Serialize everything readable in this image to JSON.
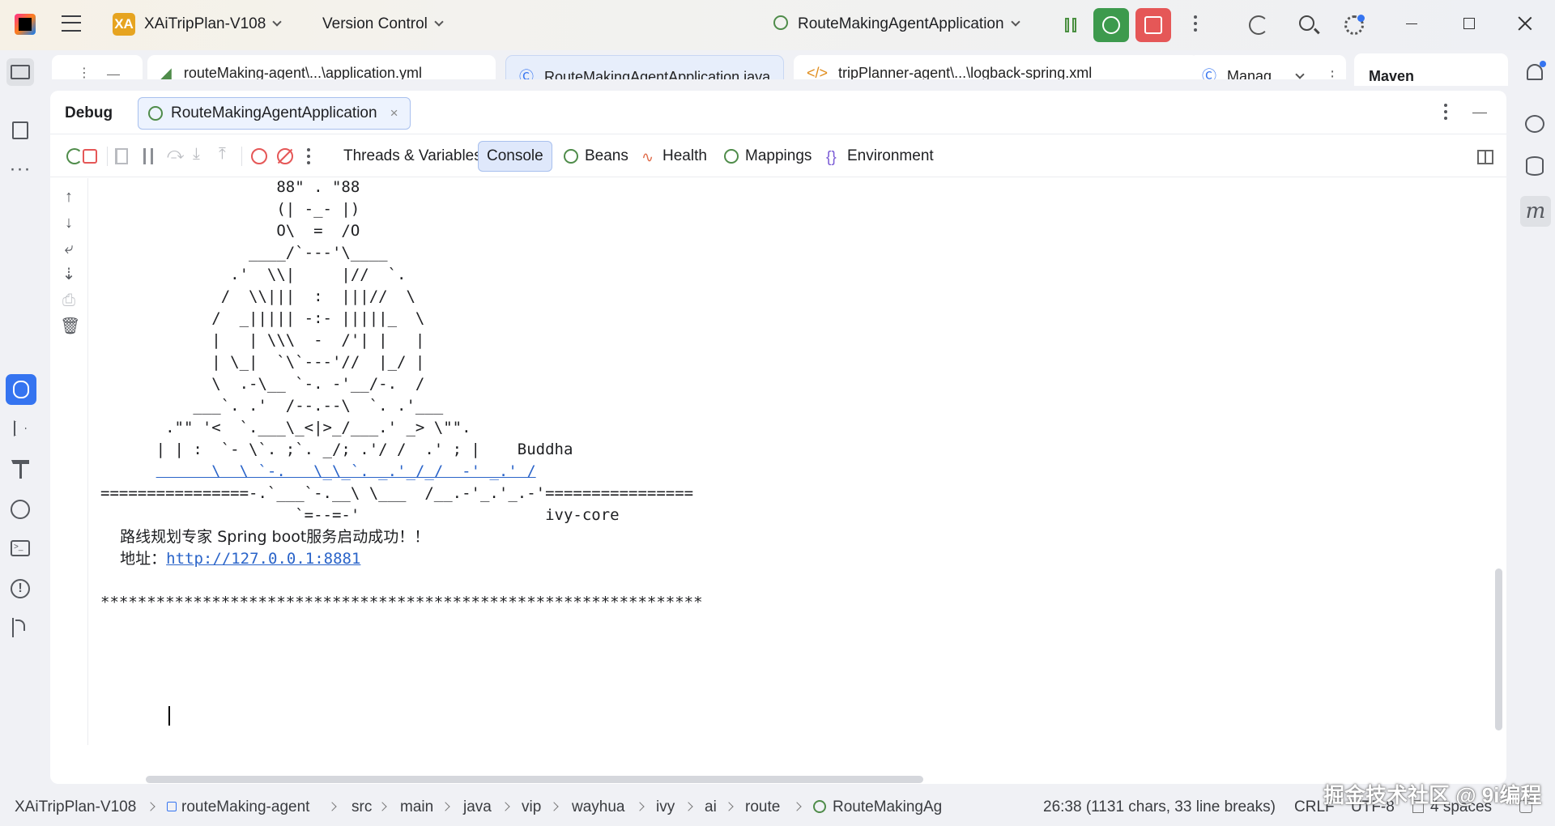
{
  "titlebar": {
    "project_badge": "XA",
    "project_name": "XAiTripPlan-V108",
    "vcs_label": "Version Control",
    "run_config": "RouteMakingAgentApplication"
  },
  "editor_tabs": [
    {
      "label": "routeMaking-agent\\...\\application.yml"
    },
    {
      "label": "RouteMakingAgentApplication.java"
    },
    {
      "label": "tripPlanner-agent\\...\\logback-spring.xml"
    },
    {
      "label": "Manag"
    }
  ],
  "right_panel_tab": "Maven",
  "debug": {
    "title": "Debug",
    "session_tab": "RouteMakingAgentApplication",
    "toolbar_tabs": {
      "threads": "Threads & Variables",
      "console": "Console",
      "beans": "Beans",
      "health": "Health",
      "mappings": "Mappings",
      "environment": "Environment"
    }
  },
  "console": {
    "art_lines": [
      "                   88\" . \"88",
      "                   (| -_- |)",
      "                   O\\  =  /O",
      "                ____/`---'\\____",
      "              .'  \\\\|     |//  `.",
      "             /  \\\\|||  :  |||//  \\",
      "            /  _||||| -:- |||||_  \\",
      "            |   | \\\\\\  -  /'| |   |",
      "            | \\_|  `\\`---'//  |_/ |",
      "            \\  .-\\__ `-. -'__/-.  /",
      "          ___`. .'  /--.--\\  `. .'___",
      "       .\"\" '<  `.___\\_<|>_/___.' _> \\\"\".",
      "      | | :  `- \\`. ;`. _/; .'/ /  .' ; |    Buddha"
    ],
    "link_line": "      \\  \\ `-.   \\_\\_`. _.'_/_/  -' _.' /",
    "equals_line": "================-.`___`-.__\\ \\___  /__.-'_.'_.-'================",
    "last_art_line": "                     `=--=-'                    ivy-core",
    "startup_msg": "    路线规划专家 Spring boot服务启动成功！！",
    "address_label": "    地址：",
    "address_url": "http://127.0.0.1:8881",
    "stars_line": "*****************************************************************"
  },
  "statusbar": {
    "crumbs": [
      "XAiTripPlan-V108",
      "routeMaking-agent",
      "src",
      "main",
      "java",
      "vip",
      "wayhua",
      "ivy",
      "ai",
      "route",
      "RouteMakingAg"
    ],
    "position": "26:38 (1131 chars, 33 line breaks)",
    "line_sep": "CRLF",
    "encoding": "UTF-8",
    "indent": "4 spaces"
  },
  "watermark": "掘金技术社区 @ 9i编程"
}
